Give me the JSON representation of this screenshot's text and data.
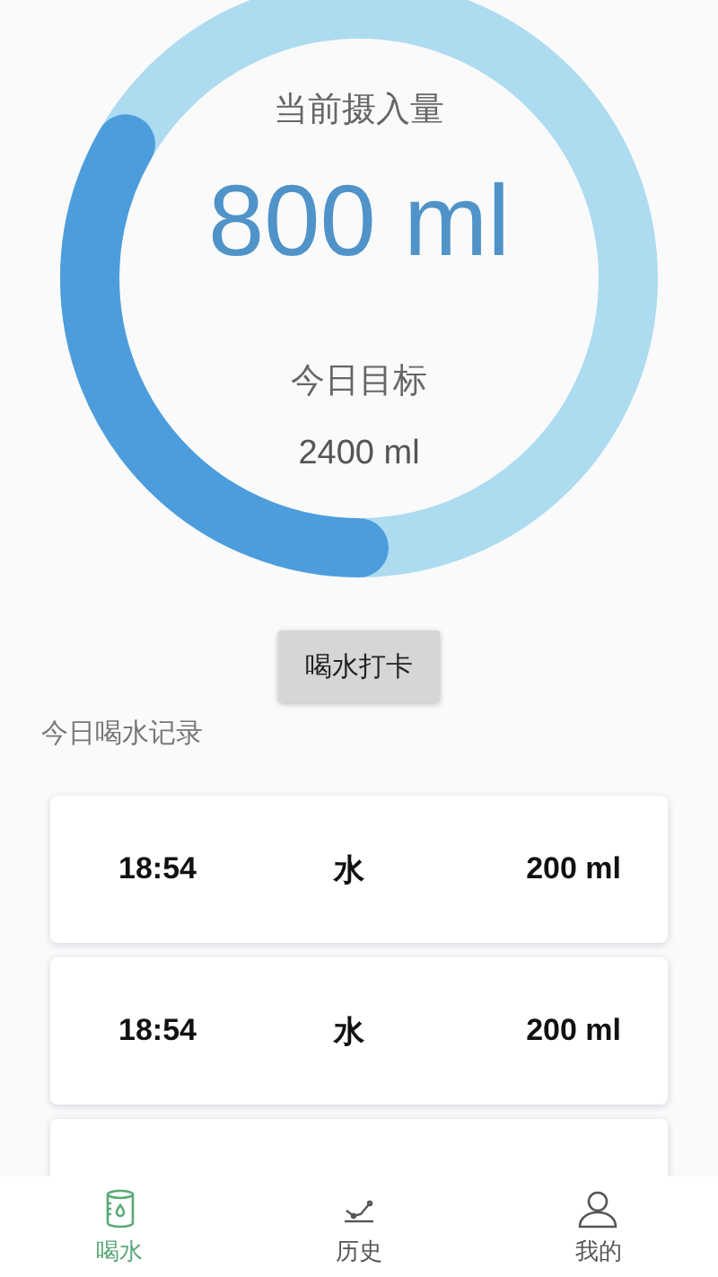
{
  "progress": {
    "label": "当前摄入量",
    "value": "800 ml",
    "goal_label": "今日目标",
    "goal": "2400 ml",
    "level": 0.333
  },
  "checkin_button": "喝水打卡",
  "records_title": "今日喝水记录",
  "records": [
    {
      "time": "18:54",
      "drink": "水",
      "amount": "200 ml"
    },
    {
      "time": "18:54",
      "drink": "水",
      "amount": "200 ml"
    }
  ],
  "nav": [
    {
      "kind": "drink",
      "label": "喝水",
      "selected": true
    },
    {
      "kind": "history",
      "label": "历史",
      "selected": false
    },
    {
      "kind": "me",
      "label": "我的",
      "selected": false
    }
  ]
}
